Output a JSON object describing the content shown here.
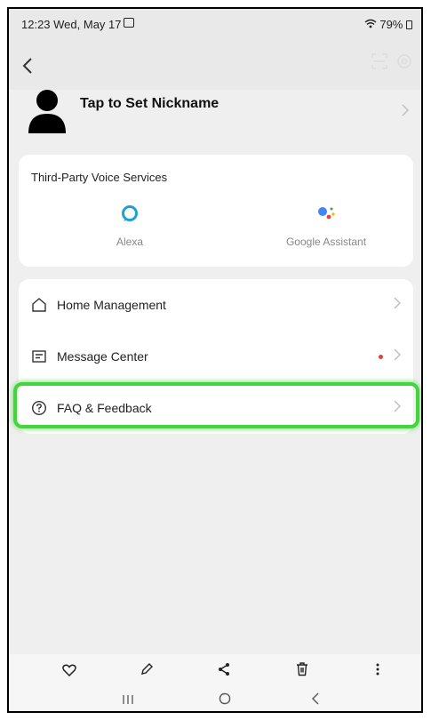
{
  "status": {
    "time": "12:23  Wed, May 17",
    "battery": "79%"
  },
  "profile": {
    "nickname": "Tap to Set Nickname"
  },
  "voice": {
    "title": "Third-Party Voice Services",
    "items": [
      {
        "label": "Alexa",
        "icon": "alexa-icon"
      },
      {
        "label": "Google Assistant",
        "icon": "google-assistant-icon"
      }
    ]
  },
  "menu": {
    "items": [
      {
        "label": "Home Management",
        "icon": "home-icon"
      },
      {
        "label": "Message Center",
        "icon": "message-icon"
      },
      {
        "label": "FAQ & Feedback",
        "icon": "question-icon"
      }
    ]
  },
  "colors": {
    "highlight": "#44d43b",
    "alexa": "#1da1d8",
    "badge": "#d8463f"
  },
  "gallery_actions": [
    "favorite-icon",
    "edit-icon",
    "share-icon",
    "delete-icon",
    "more-icon"
  ],
  "system_nav": [
    "recents-icon",
    "home-icon",
    "back-icon"
  ]
}
